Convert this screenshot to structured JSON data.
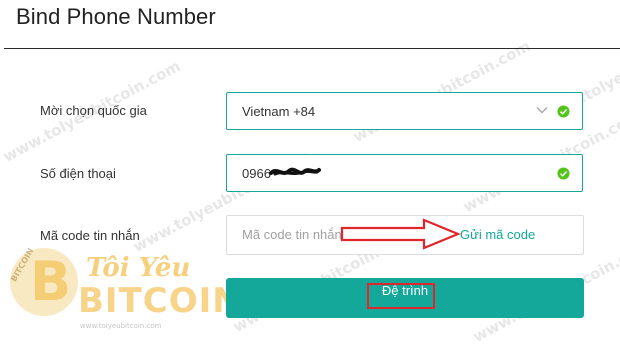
{
  "page": {
    "title": "Bind Phone Number"
  },
  "form": {
    "country": {
      "label": "Mời chọn quốc gia",
      "value": "Vietnam +84"
    },
    "phone": {
      "label": "Số điện thoại",
      "value": "0966"
    },
    "code": {
      "label": "Mã code tin nhắn",
      "placeholder": "Mã code tin nhắn",
      "send_label": "Gửi mã code"
    },
    "submit_label": "Đệ trình"
  },
  "watermark": {
    "text": "www.tolyeubitcoin.com",
    "small_text": "www.toiyeubitcoin.com",
    "logo_badge": "BITCOIN",
    "logo_script": "Tôi Yêu",
    "logo_word": "BITCOIN"
  },
  "colors": {
    "accent": "#14a89a",
    "highlight": "#e0262b",
    "valid": "#52c41a"
  },
  "icons": {
    "country_check": "check-circle-icon",
    "phone_check": "check-circle-icon",
    "dropdown": "chevron-down-icon",
    "annotation": "arrow-right-icon"
  }
}
